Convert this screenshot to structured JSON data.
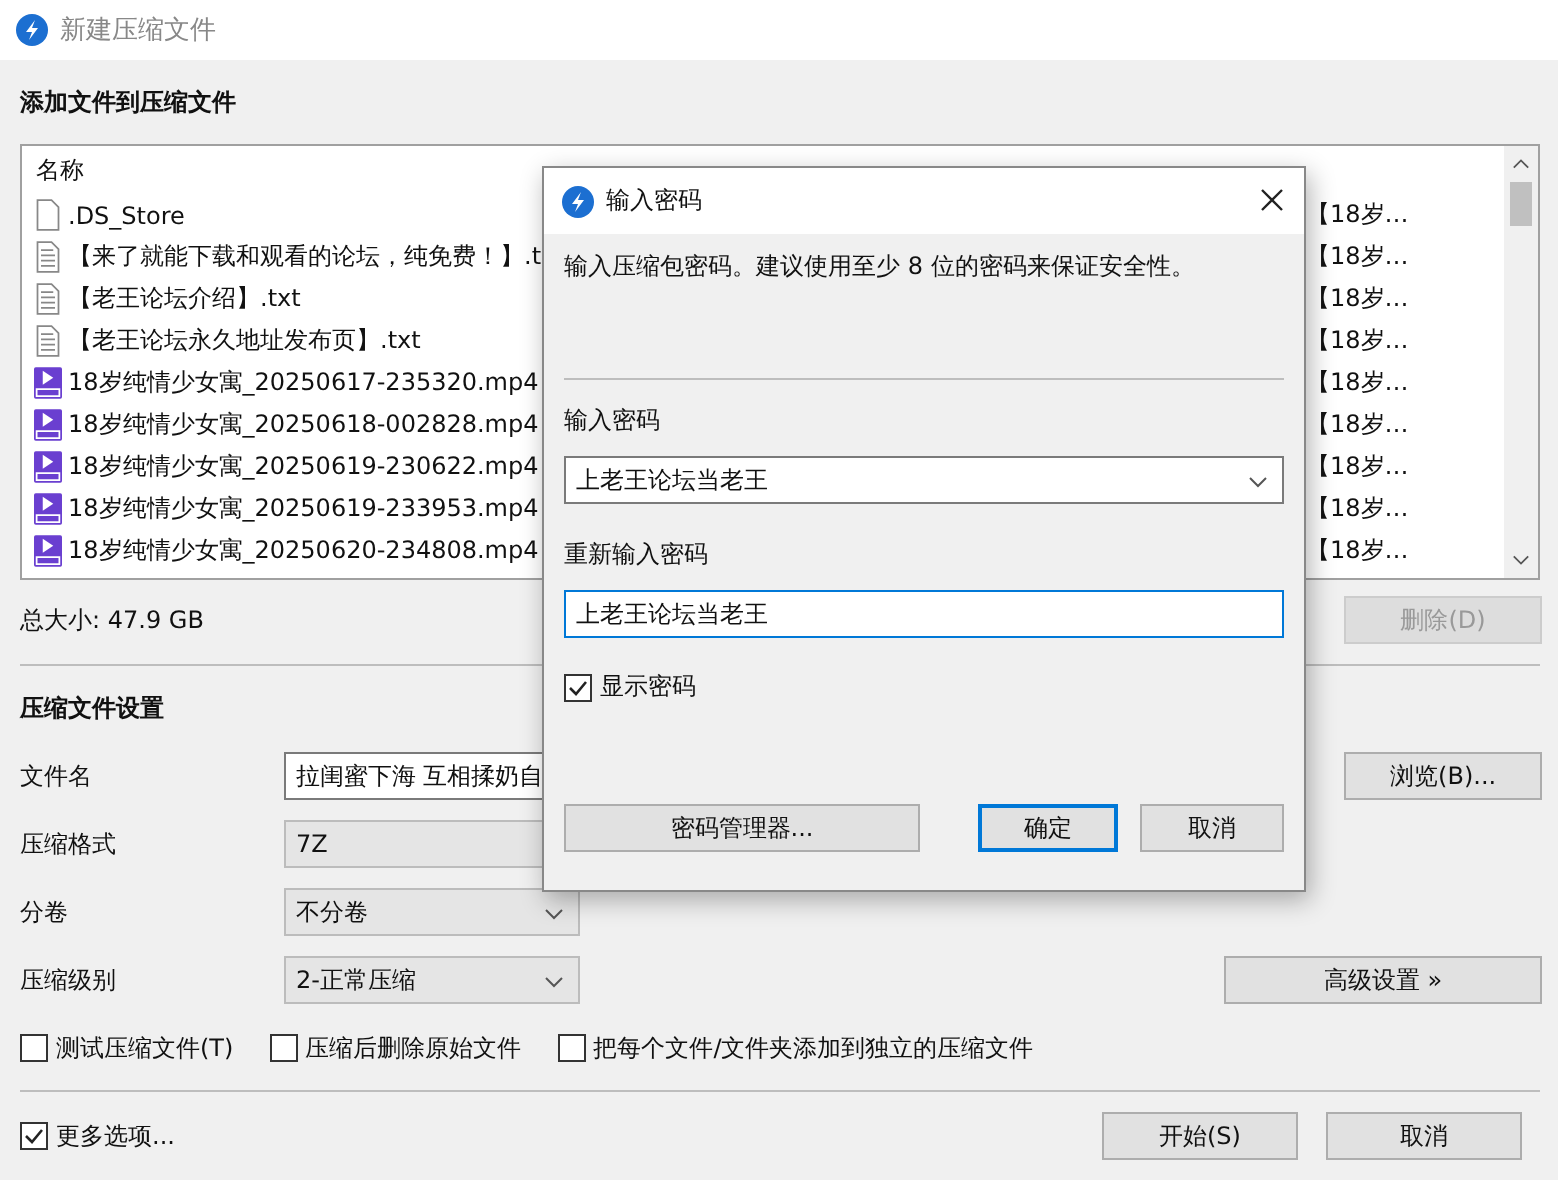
{
  "window": {
    "title": "新建压缩文件"
  },
  "files_section": {
    "heading": "添加文件到压缩文件",
    "columns": [
      "名称"
    ],
    "rows": [
      {
        "name": ".DS_Store",
        "kind": "blank",
        "column_2": "【18岁…"
      },
      {
        "name": "【来了就能下载和观看的论坛，纯免费！】.t",
        "kind": "text",
        "column_2": "【18岁…"
      },
      {
        "name": "【老王论坛介绍】.txt",
        "kind": "text",
        "column_2": "【18岁…"
      },
      {
        "name": "【老王论坛永久地址发布页】.txt",
        "kind": "text",
        "column_2": "【18岁…"
      },
      {
        "name": "18岁纯情少女寓_20250617-235320.mp4",
        "kind": "video",
        "column_2": "【18岁…"
      },
      {
        "name": "18岁纯情少女寓_20250618-002828.mp4",
        "kind": "video",
        "column_2": "【18岁…"
      },
      {
        "name": "18岁纯情少女寓_20250619-230622.mp4",
        "kind": "video",
        "column_2": "【18岁…"
      },
      {
        "name": "18岁纯情少女寓_20250619-233953.mp4",
        "kind": "video",
        "column_2": "【18岁…"
      },
      {
        "name": "18岁纯情少女寓_20250620-234808.mp4",
        "kind": "video",
        "column_2": "【18岁…"
      }
    ],
    "total_size": "总大小: 47.9 GB",
    "delete_button": {
      "label": "删除(D)",
      "disabled": true
    }
  },
  "settings": {
    "heading": "压缩文件设置",
    "file_name": {
      "label": "文件名",
      "value": "拉闺蜜下海 互相揉奶自"
    },
    "browse_button": "浏览(B)...",
    "format": {
      "label": "压缩格式",
      "value": "7Z"
    },
    "split": {
      "label": "分卷",
      "value": "不分卷"
    },
    "level": {
      "label": "压缩级别",
      "value": "2-正常压缩"
    },
    "advanced_button": "高级设置 »",
    "options": [
      {
        "label": "测试压缩文件(T)",
        "checked": false
      },
      {
        "label": "压缩后删除原始文件",
        "checked": false
      },
      {
        "label": "把每个文件/文件夹添加到独立的压缩文件",
        "checked": false
      }
    ]
  },
  "more_options": {
    "label": "更多选项...",
    "checked": true
  },
  "buttons": [
    {
      "label": "开始(S)"
    },
    {
      "label": "取消"
    }
  ],
  "password_dialog": {
    "title": "输入密码",
    "message": "输入压缩包密码。建议使用至少 8 位的密码来保证安全性。",
    "password": {
      "label": "输入密码",
      "value": "上老王论坛当老王"
    },
    "confirm": {
      "label": "重新输入密码",
      "value": "上老王论坛当老王"
    },
    "show_password": {
      "label": "显示密码",
      "checked": true
    },
    "manager_button": "密码管理器...",
    "ok_button": "确定",
    "cancel_button": "取消"
  }
}
